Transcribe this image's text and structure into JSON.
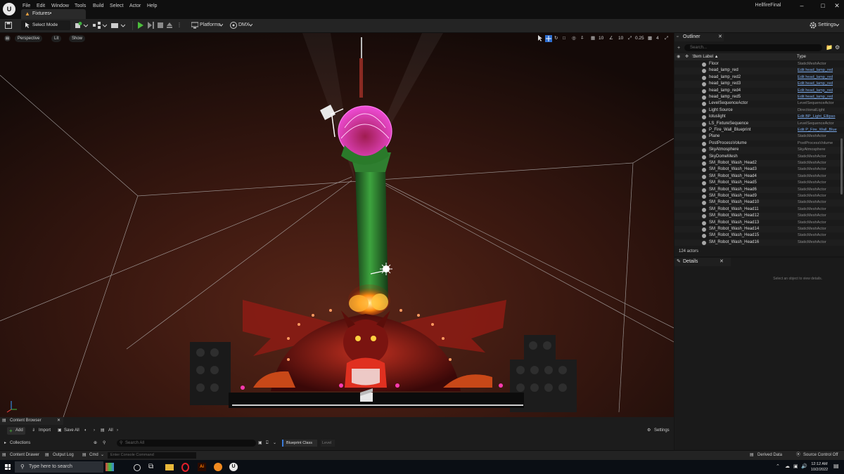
{
  "titlebar": {
    "logo": "U",
    "menu": [
      "File",
      "Edit",
      "Window",
      "Tools",
      "Build",
      "Select",
      "Actor",
      "Help"
    ],
    "tab_label": "Fixtures•",
    "project_name": "HellfireFinal",
    "win_buttons": [
      "–",
      "□",
      "✕"
    ]
  },
  "toolbar": {
    "select_mode": "Select Mode",
    "platforms": "Platforms",
    "dmx": "DMX",
    "settings": "Settings"
  },
  "viewport": {
    "perspective": "Perspective",
    "lit": "Lit",
    "show": "Show",
    "grid_size": "10",
    "rot_snap": "10",
    "scale_snap": "0.25",
    "camera_speed": "4"
  },
  "outliner": {
    "title": "Outliner",
    "search_placeholder": "Search...",
    "col_label": "Item Label ▲",
    "col_type": "Type",
    "rows": [
      {
        "label": "Floor",
        "type": "StaticMeshActor",
        "link": false
      },
      {
        "label": "head_lamp_red",
        "type": "Edit head_lamp_red",
        "link": true
      },
      {
        "label": "head_lamp_red2",
        "type": "Edit head_lamp_red",
        "link": true
      },
      {
        "label": "head_lamp_red3",
        "type": "Edit head_lamp_red",
        "link": true
      },
      {
        "label": "head_lamp_red4",
        "type": "Edit head_lamp_red",
        "link": true
      },
      {
        "label": "head_lamp_red5",
        "type": "Edit head_lamp_red",
        "link": true
      },
      {
        "label": "LevelSequenceActor",
        "type": "LevelSequenceActor",
        "link": false
      },
      {
        "label": "Light Source",
        "type": "DirectionalLight",
        "link": false
      },
      {
        "label": "lotuslight",
        "type": "Edit BP_Light_Ellipso",
        "link": true
      },
      {
        "label": "LS_FixtureSequence",
        "type": "LevelSequenceActor",
        "link": false
      },
      {
        "label": "P_Fire_Wall_Blueprint",
        "type": "Edit P_Fire_Wall_Blue",
        "link": true
      },
      {
        "label": "Plane",
        "type": "StaticMeshActor",
        "link": false
      },
      {
        "label": "PostProcessVolume",
        "type": "PostProcessVolume",
        "link": false
      },
      {
        "label": "SkyAtmosphere",
        "type": "SkyAtmosphere",
        "link": false
      },
      {
        "label": "SkyDomeMesh",
        "type": "StaticMeshActor",
        "link": false
      },
      {
        "label": "SM_Robot_Wash_Head2",
        "type": "StaticMeshActor",
        "link": false
      },
      {
        "label": "SM_Robot_Wash_Head3",
        "type": "StaticMeshActor",
        "link": false
      },
      {
        "label": "SM_Robot_Wash_Head4",
        "type": "StaticMeshActor",
        "link": false
      },
      {
        "label": "SM_Robot_Wash_Head5",
        "type": "StaticMeshActor",
        "link": false
      },
      {
        "label": "SM_Robot_Wash_Head6",
        "type": "StaticMeshActor",
        "link": false
      },
      {
        "label": "SM_Robot_Wash_Head9",
        "type": "StaticMeshActor",
        "link": false
      },
      {
        "label": "SM_Robot_Wash_Head10",
        "type": "StaticMeshActor",
        "link": false
      },
      {
        "label": "SM_Robot_Wash_Head11",
        "type": "StaticMeshActor",
        "link": false
      },
      {
        "label": "SM_Robot_Wash_Head12",
        "type": "StaticMeshActor",
        "link": false
      },
      {
        "label": "SM_Robot_Wash_Head13",
        "type": "StaticMeshActor",
        "link": false
      },
      {
        "label": "SM_Robot_Wash_Head14",
        "type": "StaticMeshActor",
        "link": false
      },
      {
        "label": "SM_Robot_Wash_Head15",
        "type": "StaticMeshActor",
        "link": false
      },
      {
        "label": "SM_Robot_Wash_Head16",
        "type": "StaticMeshActor",
        "link": false
      }
    ],
    "actor_count": "124 actors"
  },
  "details": {
    "title": "Details",
    "empty_text": "Select an object to view details."
  },
  "content_browser": {
    "title": "Content Browser",
    "add": "Add",
    "import": "Import",
    "save_all": "Save All",
    "path": "All",
    "settings": "Settings",
    "collections": "Collections",
    "search_placeholder": "Search All",
    "filter_blueprint": "Blueprint Class",
    "filter_level": "Level"
  },
  "statusbar": {
    "content_drawer": "Content Drawer",
    "output_log": "Output Log",
    "cmd": "Cmd",
    "console_placeholder": "Enter Console Command",
    "derived_data": "Derived Data",
    "source_control": "Source Control Off"
  },
  "taskbar": {
    "search_placeholder": "Type here to search",
    "time": "12:12 AM",
    "date": "10/2/2022"
  },
  "colors": {
    "accent": "#3a7ad8",
    "link": "#7aa8e8",
    "lotus": "#e040c8",
    "pillar": "#2e8a30",
    "fire": "#ff7a10"
  }
}
